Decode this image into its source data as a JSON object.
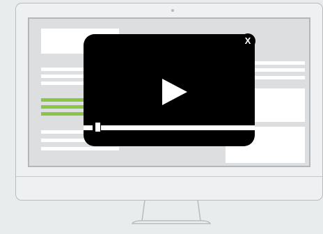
{
  "video_popup": {
    "close_label": "X",
    "progress": 0.1,
    "icons": {
      "play": "play-icon",
      "close": "close-icon"
    }
  },
  "colors": {
    "background": "#e9eced",
    "popup": "#000000",
    "accent_green": "#8ac544",
    "monitor_outline": "#b9bcbe"
  }
}
